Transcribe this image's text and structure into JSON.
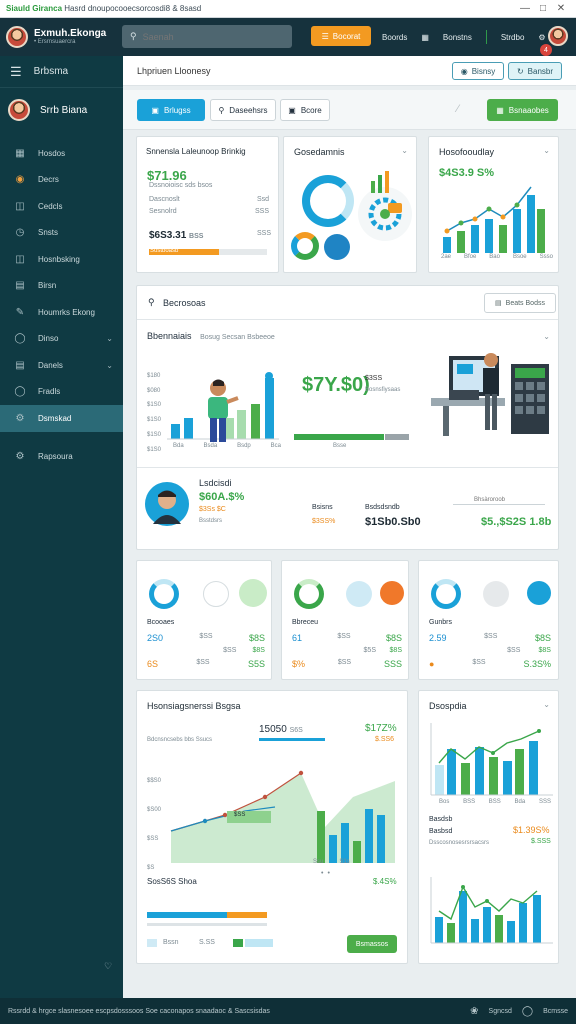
{
  "window": {
    "title_green": "Siauld Giranca",
    "title_rest": "Hasrd dnoupocooecsorcosdi8 & 8sasd"
  },
  "topbar": {
    "brand": "Exmuh.Ekonga",
    "brand_sub": "• Ersrnsuaercra",
    "search_placeholder": "Saenah",
    "orange_button": "Bocorat",
    "links": [
      "Boords",
      "Bonstns",
      "Strdbo"
    ],
    "notif": "4"
  },
  "sidebar": {
    "header": "Brbsma",
    "user": "Srrb Biana",
    "items": [
      {
        "label": "Hosdos",
        "icon": "grid-icon"
      },
      {
        "label": "Decrs",
        "icon": "tag-icon"
      },
      {
        "label": "Cedcls",
        "icon": "table-icon"
      },
      {
        "label": "Snsts",
        "icon": "clock-icon"
      },
      {
        "label": "Hosnbsking",
        "icon": "inbox-icon"
      },
      {
        "label": "Birsn",
        "icon": "calendar-icon"
      },
      {
        "label": "Houmrks Ekong",
        "icon": "pen-icon"
      },
      {
        "label": "Dinso",
        "icon": "shield-icon"
      },
      {
        "label": "Danels",
        "icon": "layers-icon"
      },
      {
        "label": "Fradls",
        "icon": "user-icon"
      },
      {
        "label": "Dsmskad",
        "icon": "gear-icon"
      },
      {
        "label": "Rapsoura",
        "icon": "settings-icon"
      }
    ]
  },
  "pagehead": {
    "title": "Lhpriuen Lloonesy",
    "btn1": "Bisnsy",
    "btn2": "Bansbr"
  },
  "toolbar": {
    "btn1": "Brlugss",
    "btn2": "Daseehsrs",
    "btn3": "Bcore",
    "btn4": "Bsnaaobes"
  },
  "card_a": {
    "title": "Snnensla Laleunoop Brinkig",
    "value": "$71.96",
    "rows": [
      "Dssnoioisc sds bsos",
      "Dascnoslt",
      "Sesnolrd"
    ],
    "row_vals": [
      "Ssd",
      "SSS",
      "SSS"
    ],
    "value2": "$6S3.31",
    "value2_suffix": "BSS",
    "bar_label": "Sostboasb"
  },
  "card_b": {
    "title": "Gosedamnis"
  },
  "card_c": {
    "title": "Hosofooudlay",
    "value": "$4S3.9 S%",
    "x_labels": [
      "2ae",
      "Bfoe",
      "Bao",
      "Bsoe",
      "Ssso"
    ]
  },
  "report": {
    "title": "Becrosoas",
    "button": "Beats Bodss",
    "sub_title": "Bbennaiais",
    "sub_desc": "Bosug Secsan Bsbeeoe",
    "big_value": "$7Y.$0)",
    "note": "$3SS",
    "note2": "Bosnsfiysaas",
    "y_labels": [
      "$180",
      "$080",
      "$1S0",
      "$1S0",
      "$1S0",
      "$1S0"
    ],
    "x_labels": [
      "Bda",
      "Bsda",
      "Bsdp",
      "Bca",
      "Bsse"
    ]
  },
  "profit": {
    "title": "Lsdcisdi",
    "value": "$60A.$%",
    "value2": "$3Ss $C",
    "value3": "Bsstdsrs",
    "cols": [
      {
        "label": "Bsisns",
        "value": "$3SS%"
      },
      {
        "label": "Bsdsdsndb",
        "value": "$1Sb0.Sb0"
      },
      {
        "label": "Bhsàroroob",
        "value": "$5.,$S2S 1.8b"
      }
    ]
  },
  "mini": [
    {
      "title": "Bcooaes",
      "rows": [
        {
          "k": "2S0",
          "v": "$SS",
          "c": "$8S"
        },
        {
          "k": "",
          "v": "$SS",
          "c": "$8S"
        },
        {
          "k": "6S",
          "v": "$SS",
          "c": "S5S"
        }
      ]
    },
    {
      "title": "Bbreceu",
      "rows": [
        {
          "k": "61",
          "v": "$SS",
          "c": "$8S"
        },
        {
          "k": "",
          "v": "$5S",
          "c": "$8S"
        },
        {
          "k": "$%",
          "v": "$SS",
          "c": "SSS"
        }
      ]
    },
    {
      "title": "Gunbrs",
      "rows": [
        {
          "k": "2.59",
          "v": "$SS",
          "c": "$8S"
        },
        {
          "k": "",
          "v": "$SS",
          "c": "$8S"
        },
        {
          "k": "",
          "v": "$SS",
          "c": "S.3S%"
        }
      ]
    }
  ],
  "chart_big": {
    "title": "Hsonsiagsnerssi Bsgsa",
    "v1": "15050",
    "v1_suffix": "S6S",
    "v2": "$17Z%",
    "v2_suffix": "$.SS6",
    "desc": "Bdcnsncsebs bbs Ssucs",
    "y_labels": [
      "$$S0",
      "$S00",
      "$SS",
      "$S"
    ],
    "tag": "$SS",
    "x_labels": [
      "Ssu",
      "S1s"
    ],
    "footer_title": "SosS6S Shoa",
    "footer_value": "$.4S%",
    "legend": [
      "Bssn",
      "S.SS"
    ],
    "button": "Bsmassos"
  },
  "chart_side": {
    "title": "Dsospdia",
    "x_labels": [
      "Bos",
      "BSS",
      "BSS",
      "Bda",
      "SSS"
    ],
    "row_title": "Basdsb",
    "row_sub": "Basbsd",
    "row_desc": "Dsscosnosesrsrsacsrs",
    "value": "$1.39S%",
    "value2": "$.SSS"
  },
  "footer": {
    "left": "Rssrdd & hrgce slasnesoee escpsdosssoos Soe caconapos snaadaoc & Sascsisdas",
    "right1": "Sgncsd",
    "right2": "Bcmsse"
  }
}
